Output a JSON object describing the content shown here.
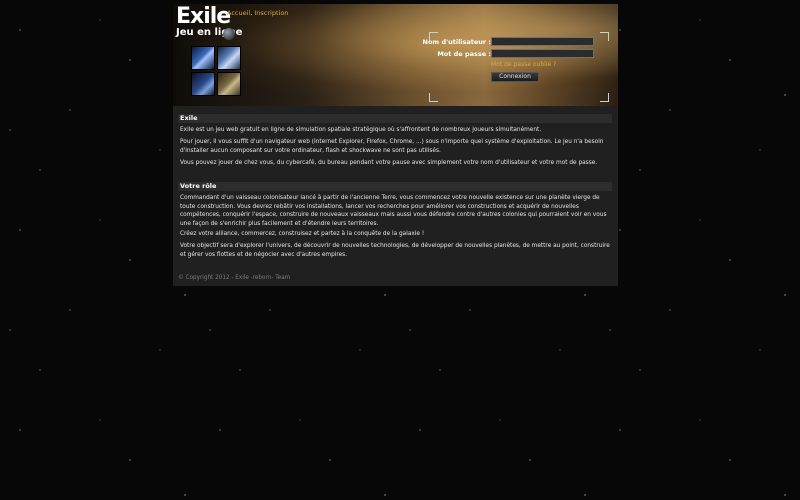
{
  "header": {
    "logo_title": "Exile",
    "logo_subtitle": "Jeu en ligne",
    "nav": {
      "home": "Accueil",
      "separator": ",",
      "register": "Inscription"
    }
  },
  "login": {
    "username_label": "Nom d'utilisateur :",
    "password_label": "Mot de passe :",
    "username_value": "",
    "password_value": "",
    "forgot_password": "Mot de passe oublié ?",
    "submit": "Connexion"
  },
  "sections": {
    "intro": {
      "title": "Exile",
      "p1": "Exile est un jeu web gratuit en ligne de simulation spatiale stratégique où s'affrontent de nombreux joueurs simultanément.",
      "p2": "Pour jouer, il vous suffit d'un navigateur web (Internet Explorer, Firefox, Chrome, ...) sous n'importe quel système d'exploitation. Le jeu n'a besoin d'installer aucun composant sur votre ordinateur, flash et shockwave ne sont pas utilisés.",
      "p3": "Vous pouvez jouer de chez vous, du cybercafé, du bureau pendant votre pause avec simplement votre nom d'utilisateur et votre mot de passe."
    },
    "role": {
      "title": "Votre rôle",
      "p1": "Commandant d'un vaisseau colonisateur lancé à partir de l'ancienne Terre, vous commencez votre nouvelle existence sur une planète vierge de toute construction. Vous devrez rebâtir vos installations, lancer vos recherches pour améliorer vos constructions et acquérir de nouvelles compétences, conquérir l'espace, construire de nouveaux vaisseaux mais aussi vous défendre contre d'autres colonies qui pourraient voir en vous une façon de s'enrichir plus facilement et d'étendre leurs territoires.",
      "p2": "Créez votre alliance, commercez, construisez et partez à la conquête de la galaxie !",
      "p3": "Votre objectif sera d'explorer l'univers, de découvrir de nouvelles technologies, de développer de nouvelles planètes, de mettre au point, construire et gérer vos flottes et de négocier avec d'autres empires."
    }
  },
  "footer": {
    "copyright": "© Copyright 2012 - Exile -reborn- Team"
  },
  "colors": {
    "accent": "#d7a948",
    "page_bg": "#202020",
    "section_bar": "#2d2d2d"
  }
}
